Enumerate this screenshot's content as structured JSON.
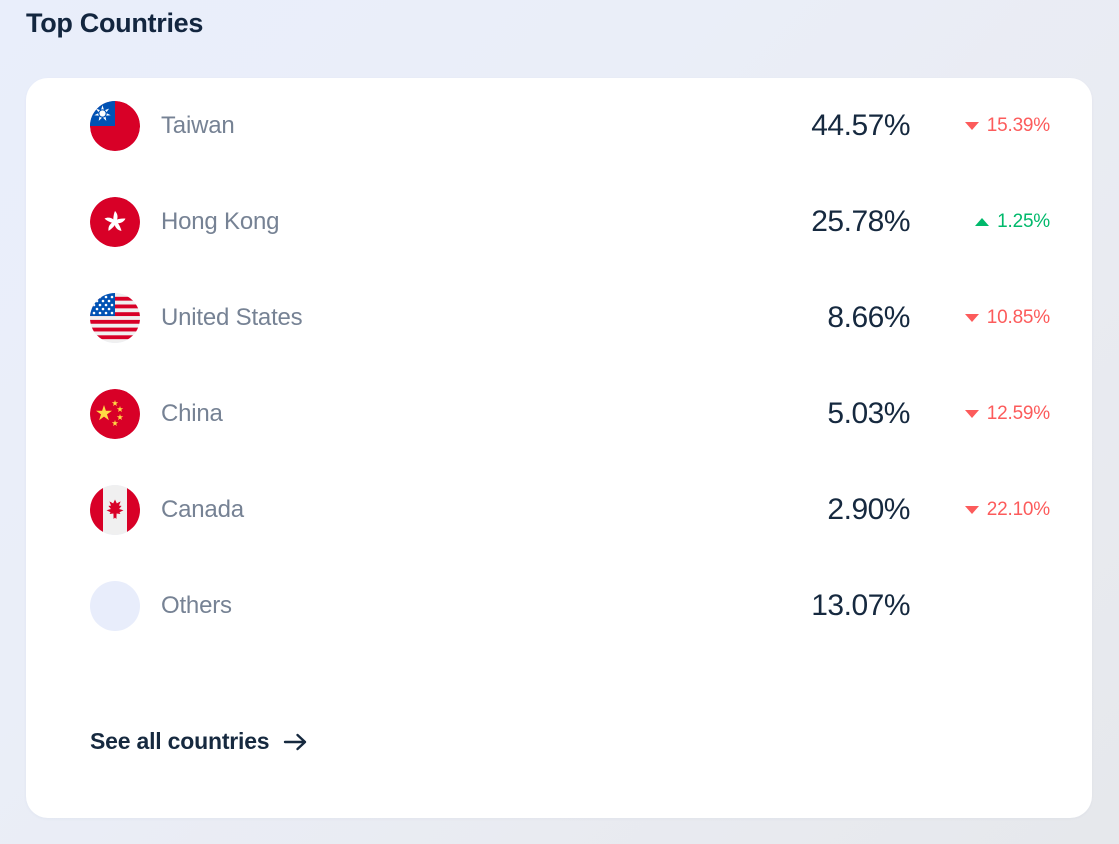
{
  "header": {
    "title": "Top Countries"
  },
  "card": {
    "rows": [
      {
        "flag": "taiwan-flag-icon",
        "name": "Taiwan",
        "value": "44.57%",
        "delta": "15.39%",
        "direction": "down"
      },
      {
        "flag": "hong-kong-flag-icon",
        "name": "Hong Kong",
        "value": "25.78%",
        "delta": "1.25%",
        "direction": "up"
      },
      {
        "flag": "united-states-flag-icon",
        "name": "United States",
        "value": "8.66%",
        "delta": "10.85%",
        "direction": "down"
      },
      {
        "flag": "china-flag-icon",
        "name": "China",
        "value": "5.03%",
        "delta": "12.59%",
        "direction": "down"
      },
      {
        "flag": "canada-flag-icon",
        "name": "Canada",
        "value": "2.90%",
        "delta": "22.10%",
        "direction": "down"
      },
      {
        "flag": "others-placeholder-icon",
        "name": "Others",
        "value": "13.07%",
        "delta": "",
        "direction": "none"
      }
    ],
    "see_all_label": "See all countries",
    "see_all_arrow": "arrow-right-icon"
  },
  "colors": {
    "title": "#13263f",
    "value": "#16293f",
    "country_name": "#768294",
    "down": "#fc5b5b",
    "up": "#00b96b",
    "card_bg": "#ffffff",
    "page_bg": "#e9eefb",
    "others_circle": "#e8edfb"
  }
}
